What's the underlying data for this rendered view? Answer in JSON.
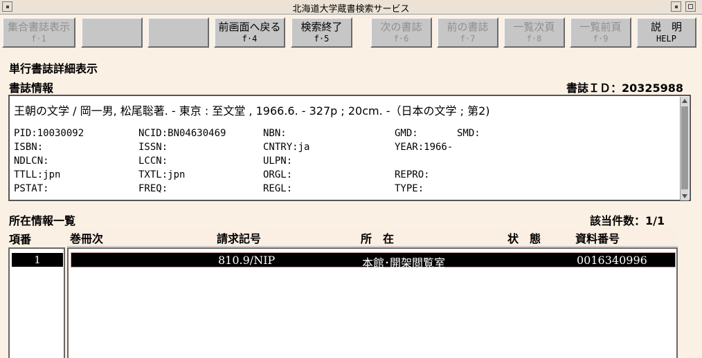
{
  "window": {
    "title": "北海道大学蔵書検索サービス"
  },
  "toolbar": {
    "buttons": [
      {
        "label": "集合書誌表示",
        "key": "f·1",
        "enabled": false
      },
      {
        "label": "",
        "key": "",
        "enabled": false
      },
      {
        "label": "",
        "key": "",
        "enabled": false
      },
      {
        "label": "前画面へ戻る",
        "key": "f·4",
        "enabled": true
      },
      {
        "label": "検索終了",
        "key": "f·5",
        "enabled": true
      },
      {
        "label": "次の書誌",
        "key": "f·6",
        "enabled": false
      },
      {
        "label": "前の書誌",
        "key": "f·7",
        "enabled": false
      },
      {
        "label": "一覧次頁",
        "key": "f·8",
        "enabled": false
      },
      {
        "label": "一覧前頁",
        "key": "f·9",
        "enabled": false
      },
      {
        "label": "説　明",
        "key": "HELP",
        "enabled": true
      }
    ]
  },
  "page": {
    "heading": "単行書誌詳細表示",
    "section_bib": "書誌情報",
    "bib_id": "書誌ＩＤ：20325988"
  },
  "bib": {
    "title_line": "王朝の文学 / 岡一男, 松尾聡著. - 東京 : 至文堂 , 1966.6. - 327p ; 20cm. -（日本の文学 ; 第2)",
    "fields": {
      "pid": "PID:10030092",
      "ncid": "NCID:BN04630469",
      "nbn": "NBN:",
      "gmd": "GMD:",
      "smd": "SMD:",
      "isbn": "ISBN:",
      "issn": "ISSN:",
      "cntry": "CNTRY:ja",
      "year": "YEAR:1966-",
      "ndlcn": "NDLCN:",
      "lccn": "LCCN:",
      "ulpn": "ULPN:",
      "ttll": "TTLL:jpn",
      "txtl": "TXTL:jpn",
      "orgl": "ORGL:",
      "repro": "REPRO:",
      "pstat": "PSTAT:",
      "freq": "FREQ:",
      "regl": "REGL:",
      "type": "TYPE:"
    }
  },
  "holdings": {
    "section": "所在情報一覧",
    "count": "該当件数：1/1",
    "index_header": "項番",
    "columns": {
      "volume": "巻冊次",
      "call_number": "請求記号",
      "location": "所　在",
      "status": "状　態",
      "material_id": "資料番号"
    },
    "rows": [
      {
        "index": "1",
        "volume": "",
        "call_number": "810.9/NIP",
        "location": "本館･開架閲覧室",
        "status": "",
        "material_id": "0016340996"
      }
    ]
  }
}
